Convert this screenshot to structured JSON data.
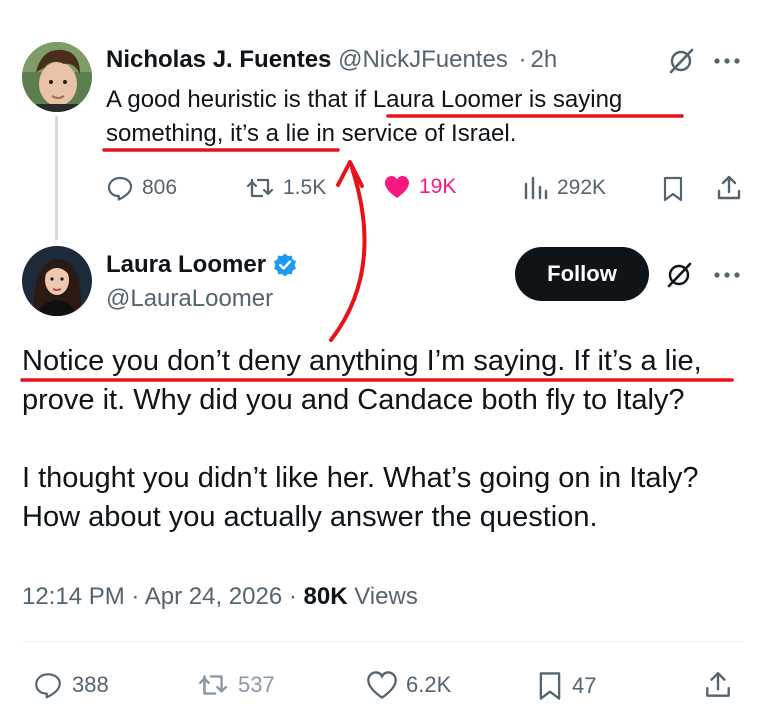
{
  "reply_tweet": {
    "display_name": "Nicholas J. Fuentes",
    "handle": "@NickJFuentes",
    "separator": "·",
    "time": "2h",
    "text": "A good heuristic is that if Laura Loomer is saying something, it’s a lie in service of Israel.",
    "actions": {
      "replies": "806",
      "reposts": "1.5K",
      "likes": "19K",
      "views": "292K"
    }
  },
  "main_tweet": {
    "display_name": "Laura Loomer",
    "handle": "@LauraLoomer",
    "follow_label": "Follow",
    "paragraphs": [
      "Notice you don’t deny anything I’m saying. If it’s a lie, prove it. Why did you and Candace both fly to Italy?",
      "I thought you didn’t like her. What’s going on in Italy? How about you actually answer the question."
    ],
    "time": "12:14 PM",
    "date": "Apr 24, 2026",
    "separator": "·",
    "views_count": "80K",
    "views_label": "Views",
    "actions": {
      "replies": "388",
      "reposts": "537",
      "likes": "6.2K",
      "bookmarks": "47"
    }
  },
  "colors": {
    "text": "#0f1419",
    "muted": "#536471",
    "like_pink": "#f91880",
    "verified_blue": "#1d9bf0",
    "annotation_red": "#e8131a"
  }
}
